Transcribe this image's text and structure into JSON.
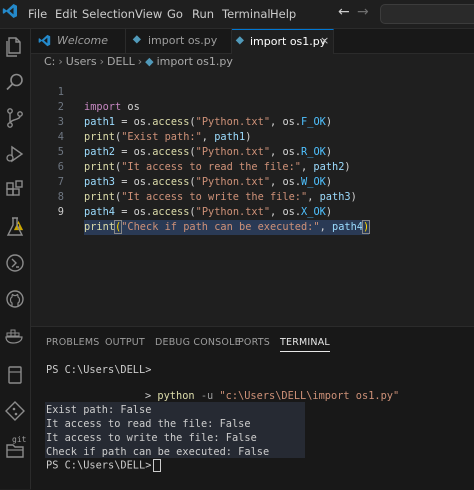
{
  "menu": [
    "File",
    "Edit",
    "Selection",
    "View",
    "Go",
    "Run",
    "Terminal",
    "Help"
  ],
  "nav": {
    "back": "←",
    "forward": "→"
  },
  "activity_icons": [
    "explorer-icon",
    "search-icon",
    "source-control-icon",
    "run-debug-icon",
    "extensions-icon",
    "testing-icon",
    "remote-explorer-icon",
    "github-icon",
    "docker-icon",
    "git-icon",
    "folder-icon"
  ],
  "git_label": "git",
  "tabs": [
    {
      "label": "Welcome",
      "icon": "vscode-logo-icon"
    },
    {
      "label": "import os.py",
      "icon": "python-file-icon"
    },
    {
      "label": "import os1.py",
      "icon": "python-file-icon",
      "active": true
    }
  ],
  "tab_close": "×",
  "breadcrumb": [
    "C:",
    "Users",
    "DELL",
    "import os1.py"
  ],
  "line_numbers": [
    "1",
    "2",
    "3",
    "4",
    "5",
    "6",
    "7",
    "8",
    "9"
  ],
  "code": {
    "l1": {
      "kw": "import",
      "sp": " ",
      "mod": "os"
    },
    "l2": {
      "var": "path1",
      "eq": " = ",
      "obj": "os",
      "dot": ".",
      "fn": "access",
      "op": "(",
      "s": "\"Python.txt\"",
      "cm": ", ",
      "obj2": "os",
      "dot2": ".",
      "cst": "F_OK",
      "cl": ")"
    },
    "l3": {
      "fn": "print",
      "op": "(",
      "s": "\"Exist path:\"",
      "cm": ", ",
      "var": "path1",
      "cl": ")"
    },
    "l4": {
      "var": "path2",
      "eq": " = ",
      "obj": "os",
      "dot": ".",
      "fn": "access",
      "op": "(",
      "s": "\"Python.txt\"",
      "cm": ", ",
      "obj2": "os",
      "dot2": ".",
      "cst": "R_OK",
      "cl": ")"
    },
    "l5": {
      "fn": "print",
      "op": "(",
      "s": "\"It access to read the file:\"",
      "cm": ", ",
      "var": "path2",
      "cl": ")"
    },
    "l6": {
      "var": "path3",
      "eq": " = ",
      "obj": "os",
      "dot": ".",
      "fn": "access",
      "op": "(",
      "s": "\"Python.txt\"",
      "cm": ", ",
      "obj2": "os",
      "dot2": ".",
      "cst": "W_OK",
      "cl": ")"
    },
    "l7": {
      "fn": "print",
      "op": "(",
      "s": "\"It access to write the file:\"",
      "cm": ", ",
      "var": "path3",
      "cl": ")"
    },
    "l8": {
      "var": "path4",
      "eq": " = ",
      "obj": "os",
      "dot": ".",
      "fn": "access",
      "op": "(",
      "s": "\"Python.txt\"",
      "cm": ", ",
      "obj2": "os",
      "dot2": ".",
      "cst": "X_OK",
      "cl": ")"
    },
    "l9": {
      "fn": "print",
      "op": "(",
      "s": "\"Check if path can be executed:\"",
      "cm": ", ",
      "var": "path4",
      "cl": ")"
    }
  },
  "panel_tabs": [
    "PROBLEMS",
    "OUTPUT",
    "DEBUG CONSOLE",
    "PORTS",
    "TERMINAL"
  ],
  "terminal": {
    "prompt1": "PS C:\\Users\\DELL>",
    "run_arrow": ">",
    "run_cmd": "python",
    "run_flag": "-u",
    "run_path": "\"c:\\Users\\DELL\\import os1.py\"",
    "output": [
      "Exist path: False",
      "It access to read the file: False",
      "It access to write the file: False",
      "Check if path can be executed: False"
    ],
    "prompt2": "PS C:\\Users\\DELL>"
  },
  "colors": {
    "accent": "#0078d4",
    "warning": "#cca700",
    "background": "#1f1f1f"
  }
}
